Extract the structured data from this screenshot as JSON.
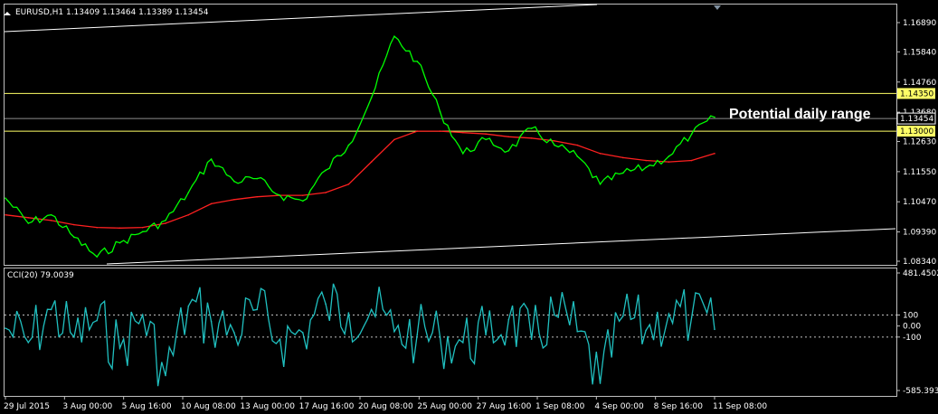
{
  "chart_data": [
    {
      "type": "line",
      "title": "EURUSD,H1  1.13409 1.13464 1.13389 1.13454",
      "y_ticks": [
        "1.16890",
        "1.15840",
        "1.14760",
        "1.13680",
        "1.12630",
        "1.11550",
        "1.10470",
        "1.09390",
        "1.08340"
      ],
      "ylim": [
        1.0834,
        1.1689
      ],
      "x_ticks": [
        "29 Jul 2015",
        "3 Aug 00:00",
        "5 Aug 16:00",
        "10 Aug 08:00",
        "13 Aug 00:00",
        "17 Aug 16:00",
        "20 Aug 08:00",
        "25 Aug 00:00",
        "27 Aug 16:00",
        "1 Sep 08:00",
        "4 Sep 00:00",
        "8 Sep 16:00",
        "11 Sep 08:00"
      ],
      "horizontal_lines": [
        {
          "value": 1.1435,
          "label": "1.14350",
          "color": "#ffff66"
        },
        {
          "value": 1.13,
          "label": "1.13000",
          "color": "#ffff66"
        }
      ],
      "current_price": {
        "value": 1.13454,
        "label": "1.13454"
      },
      "annotation": "Potential daily range",
      "series": [
        {
          "color": "#00ff00",
          "x": [
            "29 Jul 2015",
            "31 Jul",
            "3 Aug 00:00",
            "4 Aug",
            "5 Aug 16:00",
            "6 Aug",
            "7 Aug",
            "10 Aug 08:00",
            "11 Aug",
            "12 Aug",
            "13 Aug 00:00",
            "14 Aug",
            "17 Aug 16:00",
            "18 Aug",
            "19 Aug",
            "20 Aug 08:00",
            "21 Aug",
            "24 Aug",
            "25 Aug 00:00",
            "26 Aug",
            "27 Aug 16:00",
            "28 Aug",
            "31 Aug",
            "1 Sep 08:00",
            "2 Sep",
            "3 Sep",
            "4 Sep 00:00",
            "7 Sep",
            "8 Sep 16:00",
            "9 Sep",
            "10 Sep",
            "11 Sep 08:00"
          ],
          "values": [
            1.106,
            1.097,
            1.1,
            1.092,
            1.085,
            1.09,
            1.094,
            1.098,
            1.108,
            1.12,
            1.112,
            1.113,
            1.107,
            1.105,
            1.116,
            1.125,
            1.142,
            1.164,
            1.155,
            1.137,
            1.122,
            1.127,
            1.123,
            1.131,
            1.125,
            1.121,
            1.111,
            1.115,
            1.117,
            1.121,
            1.129,
            1.135
          ]
        },
        {
          "color": "#ff2020",
          "x": [
            "29 Jul 2015",
            "31 Jul",
            "3 Aug 00:00",
            "4 Aug",
            "5 Aug 16:00",
            "6 Aug",
            "7 Aug",
            "10 Aug 08:00",
            "11 Aug",
            "12 Aug",
            "13 Aug 00:00",
            "14 Aug",
            "17 Aug 16:00",
            "18 Aug",
            "19 Aug",
            "20 Aug 08:00",
            "21 Aug",
            "24 Aug",
            "25 Aug 00:00",
            "26 Aug",
            "27 Aug 16:00",
            "28 Aug",
            "31 Aug",
            "1 Sep 08:00",
            "2 Sep",
            "3 Sep",
            "4 Sep 00:00",
            "7 Sep",
            "8 Sep 16:00",
            "9 Sep",
            "10 Sep",
            "11 Sep 08:00"
          ],
          "values": [
            1.1,
            1.099,
            1.098,
            1.0965,
            1.0955,
            1.0953,
            1.0955,
            1.097,
            1.1,
            1.104,
            1.1055,
            1.1065,
            1.107,
            1.107,
            1.108,
            1.111,
            1.119,
            1.127,
            1.13,
            1.13,
            1.1295,
            1.129,
            1.128,
            1.1275,
            1.1265,
            1.125,
            1.122,
            1.1205,
            1.1195,
            1.119,
            1.1195,
            1.122
          ]
        }
      ]
    },
    {
      "type": "line",
      "title": "CCI(20) 79.0039",
      "y_ticks": [
        "481.4502",
        "100",
        "0.00",
        "-100",
        "-585.3938"
      ],
      "ylim": [
        -585.3938,
        481.4502
      ],
      "levels": [
        100,
        -100
      ],
      "series": [
        {
          "color": "#20c0c0",
          "x": [
            "29 Jul 2015",
            "31 Jul",
            "3 Aug 00:00",
            "4 Aug",
            "5 Aug 16:00",
            "6 Aug",
            "7 Aug",
            "10 Aug 08:00",
            "11 Aug",
            "12 Aug",
            "13 Aug 00:00",
            "14 Aug",
            "17 Aug 16:00",
            "18 Aug",
            "19 Aug",
            "20 Aug 08:00",
            "21 Aug",
            "24 Aug",
            "25 Aug 00:00",
            "26 Aug",
            "27 Aug 16:00",
            "28 Aug",
            "31 Aug",
            "1 Sep 08:00",
            "2 Sep",
            "3 Sep",
            "4 Sep 00:00",
            "7 Sep",
            "8 Sep 16:00",
            "9 Sep",
            "10 Sep",
            "11 Sep 08:00"
          ],
          "values": [
            -20,
            -150,
            150,
            -100,
            50,
            -200,
            100,
            -450,
            180,
            40,
            -60,
            150,
            -120,
            -60,
            200,
            120,
            150,
            -50,
            -80,
            -100,
            -150,
            -80,
            60,
            -120,
            100,
            -50,
            -520,
            90,
            -40,
            110,
            80,
            -30
          ]
        }
      ]
    }
  ]
}
